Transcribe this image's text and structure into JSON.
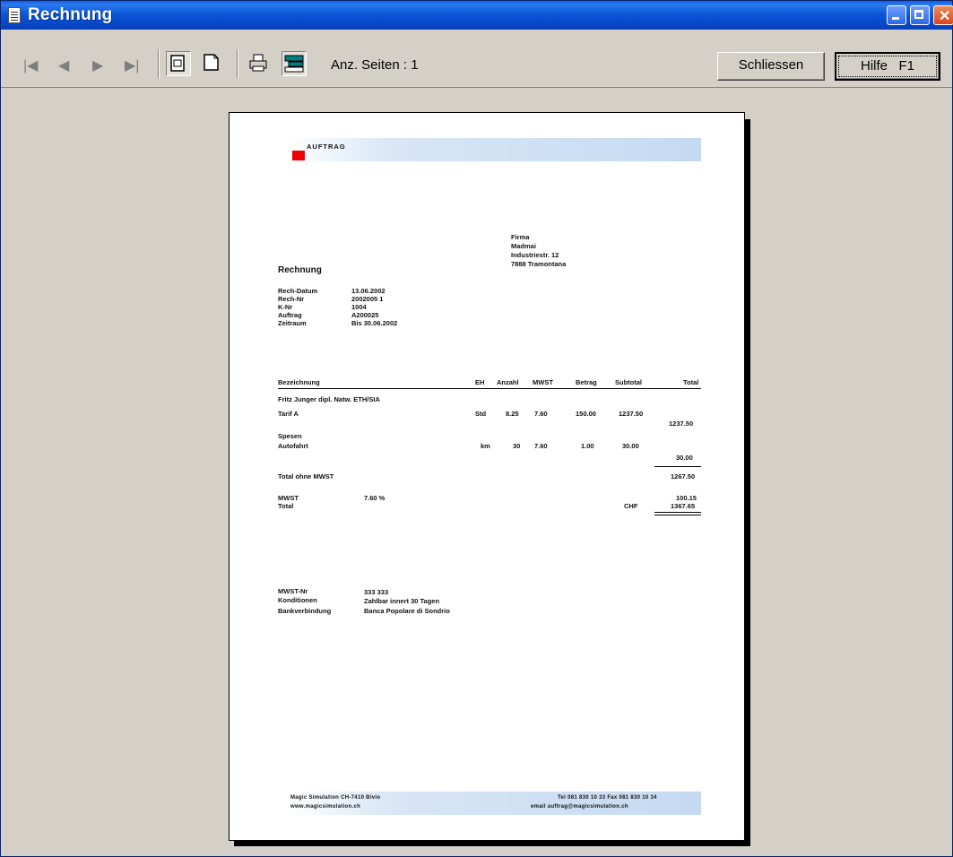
{
  "window": {
    "title": "Rechnung"
  },
  "toolbar": {
    "pages_label": "Anz. Seiten : 1",
    "close_label": "Schliessen",
    "help_label": "Hilfe   F1"
  },
  "doc": {
    "header_text": "AUFTRAG",
    "recipient": [
      "Firma",
      "Madmai",
      "Industriestr. 12",
      "7888 Tramontana"
    ],
    "title": "Rechnung",
    "info_labels": [
      "Rech-Datum",
      "Rech-Nr",
      "K-Nr",
      "Auftrag",
      "Zeitraum"
    ],
    "info_values": [
      "13.06.2002",
      "2002005 1",
      "1004",
      "A200025",
      "Bis 30.06.2002"
    ],
    "columns": [
      "Bezeichnung",
      "EH",
      "Anzahl",
      "MWST",
      "Betrag",
      "Subtotal",
      "Total"
    ],
    "group1": "Fritz Junger dipl. Natw. ETH/SIA",
    "row1": {
      "label": "Tarif A",
      "eh": "Std",
      "anzahl": "8.25",
      "mwst": "7.60",
      "betrag": "150.00",
      "subtotal": "1237.50"
    },
    "group1_total": "1237.50",
    "group2": "Spesen",
    "row2": {
      "label": "Autofahrt",
      "eh": "km",
      "anzahl": "30",
      "mwst": "7.60",
      "betrag": "1.00",
      "subtotal": "30.00"
    },
    "group2_total": "30.00",
    "total_no_tax_label": "Total ohne MWST",
    "total_no_tax": "1267.50",
    "tax_label": "MWST",
    "tax_rate": "7.60 %",
    "tax_amount": "100.15",
    "total_label": "Total",
    "currency": "CHF",
    "total": "1367.65",
    "footer_labels": [
      "MWST-Nr",
      "Konditionen",
      "Bankverbindung"
    ],
    "footer_values": [
      "333 333",
      "Zahlbar innert 30 Tagen",
      "Banca Popolare di Sondrio"
    ],
    "bottom_left_1": "Magic Simulation CH-7410 Bivio",
    "bottom_left_2": "www.magicsimulation.ch",
    "bottom_right_1": "Tel 081 830 10 33   Fax 081 830 10 34",
    "bottom_right_2": "email  auftrag@magicsimulation.ch"
  },
  "colors": {
    "title_bar": "#0a58d8",
    "accent_red": "#ee0000",
    "band_blue": "#c4daf2"
  }
}
